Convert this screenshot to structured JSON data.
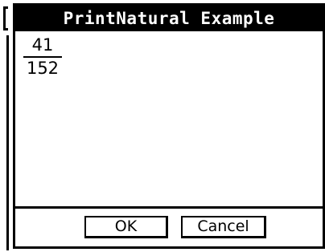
{
  "dialog": {
    "title": "PrintNatural Example"
  },
  "output": {
    "numerator": "41",
    "denominator": "152"
  },
  "buttons": {
    "ok_label": "OK",
    "cancel_label": "Cancel"
  },
  "colors": {
    "title_bg": "#000000",
    "title_fg": "#ffffff",
    "background": "#ffffff"
  }
}
